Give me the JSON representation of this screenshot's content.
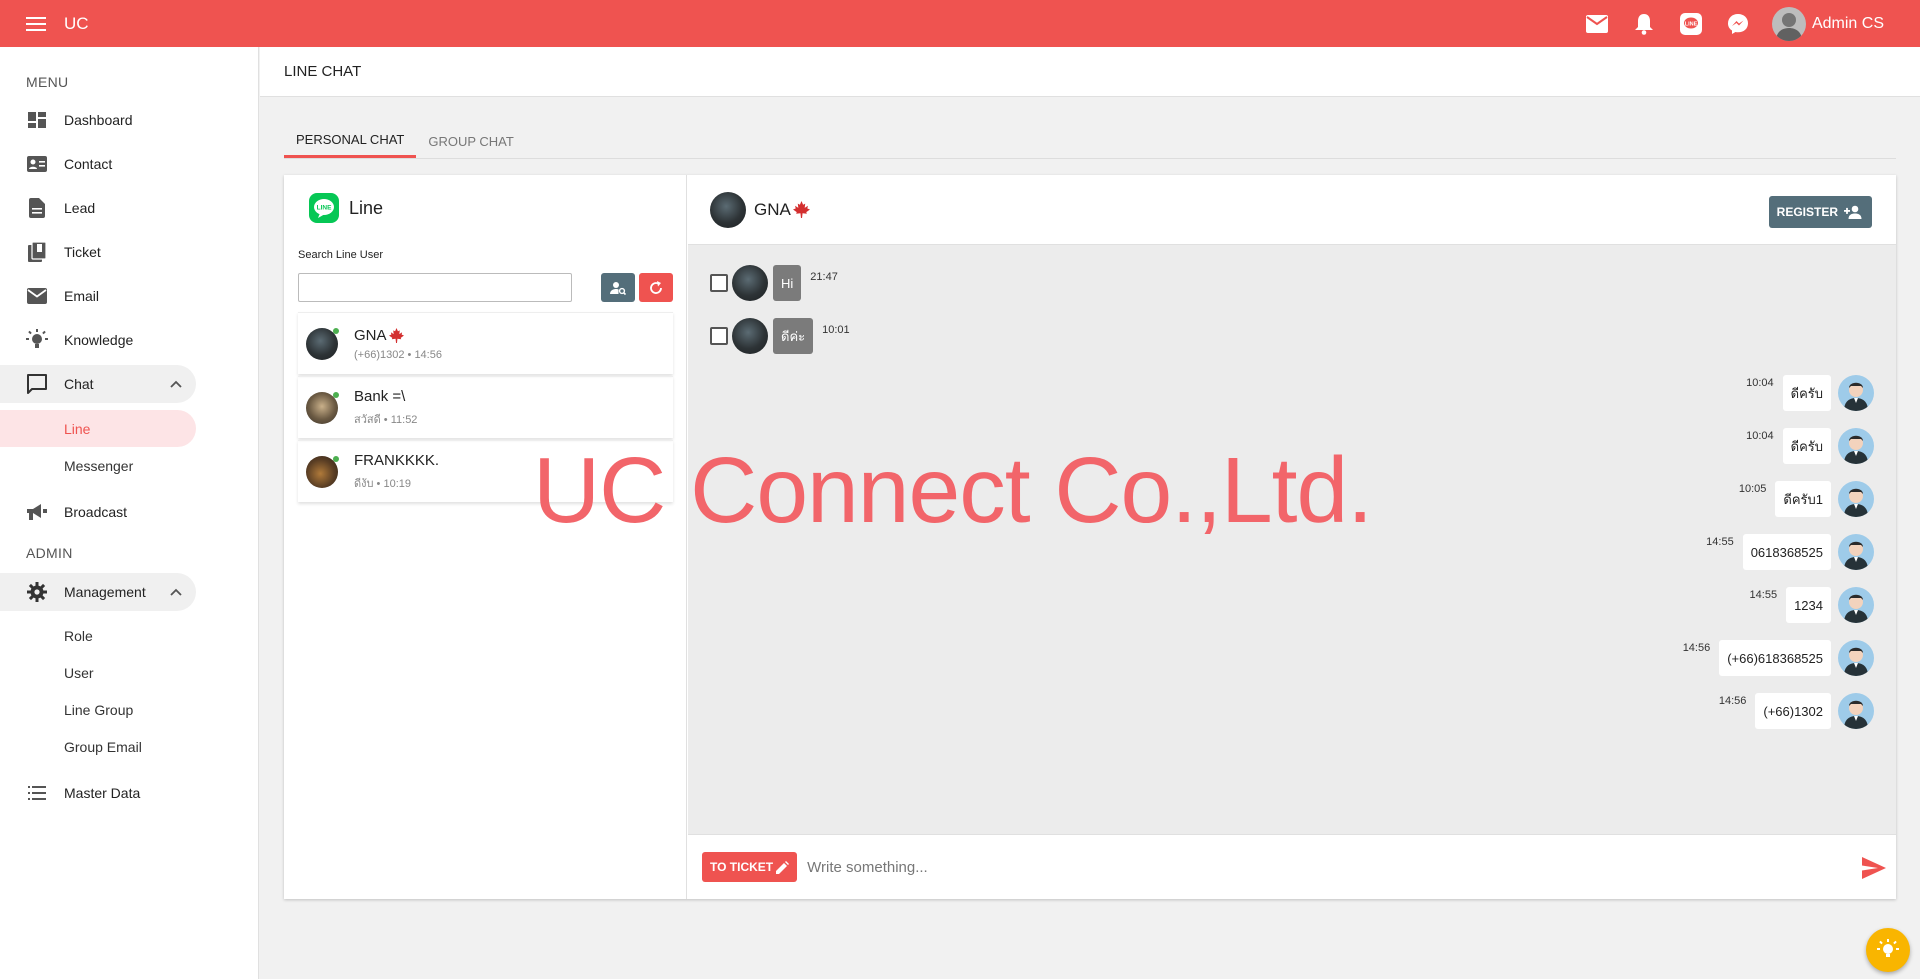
{
  "app": {
    "title": "UC",
    "user_name": "Admin CS"
  },
  "sidebar": {
    "menu_label": "MENU",
    "admin_label": "ADMIN",
    "items": {
      "dashboard": "Dashboard",
      "contact": "Contact",
      "lead": "Lead",
      "ticket": "Ticket",
      "email": "Email",
      "knowledge": "Knowledge",
      "chat": "Chat",
      "chat_line": "Line",
      "chat_messenger": "Messenger",
      "broadcast": "Broadcast",
      "management": "Management",
      "role": "Role",
      "user": "User",
      "line_group": "Line Group",
      "group_email": "Group Email",
      "master_data": "Master Data"
    }
  },
  "page": {
    "title": "LINE CHAT"
  },
  "tabs": [
    "PERSONAL CHAT",
    "GROUP CHAT"
  ],
  "line_panel": {
    "title": "Line",
    "search_label": "Search Line User",
    "search_value": "",
    "contacts": [
      {
        "name": "GNA",
        "detail": "(+66)1302",
        "time": "14:56"
      },
      {
        "name": "Bank =\\",
        "detail": "สวัสดี",
        "time": "11:52"
      },
      {
        "name": "FRANKKKK.",
        "detail": "ดีงับ",
        "time": "10:19"
      }
    ]
  },
  "chat": {
    "contact_name": "GNA",
    "register_label": "REGISTER",
    "incoming": [
      {
        "text": "Hi",
        "time": "21:47"
      },
      {
        "text": "ดีค่ะ",
        "time": "10:01"
      }
    ],
    "outgoing": [
      {
        "text": "ดีครับ",
        "time": "10:04"
      },
      {
        "text": "ดีครับ",
        "time": "10:04"
      },
      {
        "text": "ดีครับ1",
        "time": "10:05"
      },
      {
        "text": "0618368525",
        "time": "14:55"
      },
      {
        "text": "1234",
        "time": "14:55"
      },
      {
        "text": "(+66)618368525",
        "time": "14:56"
      },
      {
        "text": "(+66)1302",
        "time": "14:56"
      }
    ],
    "to_ticket_label": "TO TICKET",
    "input_placeholder": "Write something..."
  },
  "watermark": "UC Connect Co.,Ltd.",
  "colors": {
    "primary": "#ef5350",
    "line_green": "#06c755",
    "slate": "#546e7a",
    "fab": "#f9b500"
  },
  "icons": [
    "menu-icon",
    "mail-icon",
    "bell-icon",
    "line-icon",
    "messenger-icon",
    "dashboard-icon",
    "contact-icon",
    "lead-icon",
    "ticket-icon",
    "email-icon",
    "knowledge-icon",
    "chat-icon",
    "broadcast-icon",
    "gear-icon",
    "list-icon",
    "search-user-icon",
    "refresh-icon",
    "add-user-icon",
    "pencil-icon",
    "send-icon",
    "lightbulb-icon",
    "maple-leaf-icon"
  ]
}
